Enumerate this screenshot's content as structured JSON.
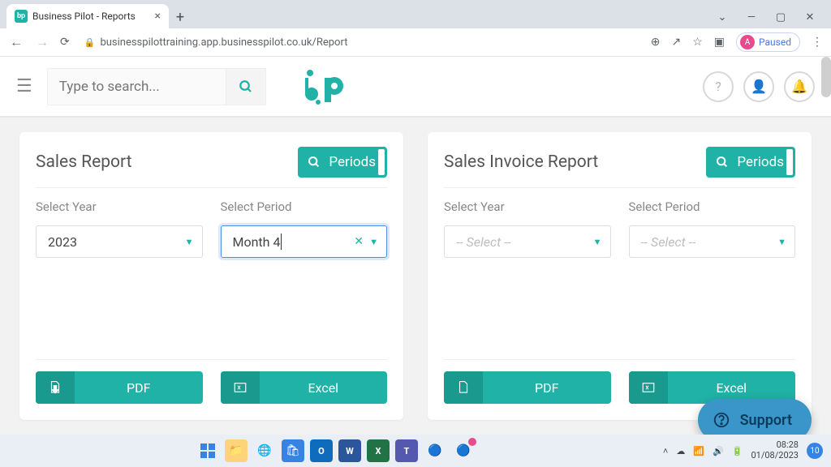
{
  "browser": {
    "tab_title": "Business Pilot - Reports",
    "url": "businesspilottraining.app.businesspilot.co.uk/Report",
    "paused_label": "Paused",
    "paused_initial": "A"
  },
  "header": {
    "search_placeholder": "Type to search..."
  },
  "cards": [
    {
      "title": "Sales Report",
      "periods_btn": "Periods",
      "year_label": "Select Year",
      "period_label": "Select Period",
      "year_value": "2023",
      "period_value": "Month 4",
      "pdf_label": "PDF",
      "excel_label": "Excel"
    },
    {
      "title": "Sales Invoice Report",
      "periods_btn": "Periods",
      "year_label": "Select Year",
      "period_label": "Select Period",
      "year_placeholder": "-- Select --",
      "period_placeholder": "-- Select --",
      "pdf_label": "PDF",
      "excel_label": "Excel"
    }
  ],
  "support": {
    "label": "Support"
  },
  "taskbar": {
    "time": "08:28",
    "date": "01/08/2023",
    "notif_count": "10"
  },
  "colors": {
    "teal": "#20b2a6",
    "teal_dark": "#1a9a8f",
    "support_blue": "#3a96c8"
  }
}
